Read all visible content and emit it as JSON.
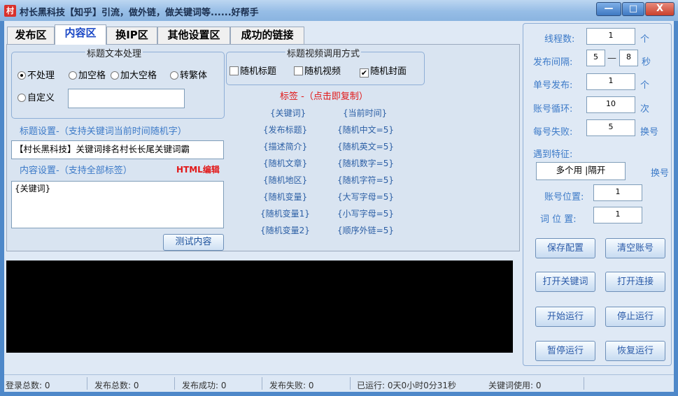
{
  "window": {
    "title": "村长黑科技【知乎】引流，做外链，做关键词等......好帮手",
    "app_icon_char": "村",
    "min_symbol": "—",
    "max_symbol": "□",
    "close_symbol": "X"
  },
  "tabs": [
    {
      "label": "发布区"
    },
    {
      "label": "内容区"
    },
    {
      "label": "换IP区"
    },
    {
      "label": "其他设置区"
    },
    {
      "label": "成功的链接"
    }
  ],
  "title_processing": {
    "group_title": "标题文本处理",
    "options": [
      "不处理",
      "加空格",
      "加大空格",
      "转繁体"
    ],
    "custom_label": "自定义",
    "custom_value": "",
    "selected": "不处理"
  },
  "video_mode": {
    "group_title": "标题视频调用方式",
    "checkboxes": [
      {
        "label": "随机标题",
        "checked": false
      },
      {
        "label": "随机视频",
        "checked": false
      },
      {
        "label": "随机封面",
        "checked": true
      }
    ]
  },
  "title_settings": {
    "label": "标题设置-（支持关键词当前时间随机字）",
    "value": "【村长黑科技】关键词排名村长长尾关键词霸"
  },
  "content_settings": {
    "label": "内容设置-（支持全部标签）",
    "html_edit": "HTML编辑",
    "value": "{关键词}",
    "test_button": "测试内容"
  },
  "tags": {
    "header": "标签 -（点击即复制）",
    "left": [
      "{关键词}",
      "{发布标题}",
      "{描述简介}",
      "{随机文章}",
      "{随机地区}",
      "{随机变量}",
      "{随机变量1}",
      "{随机变量2}"
    ],
    "right": [
      "{当前时间}",
      "{随机中文=5}",
      "{随机英文=5}",
      "{随机数字=5}",
      "{随机字符=5}",
      "{大写字母=5}",
      "{小写字母=5}",
      "{顺序外链=5}"
    ]
  },
  "right_panel": {
    "threads": {
      "label": "线程数:",
      "value": "1",
      "unit": "个"
    },
    "interval": {
      "label": "发布间隔:",
      "from": "5",
      "sep": "—",
      "to": "8",
      "unit": "秒"
    },
    "per_account": {
      "label": "单号发布:",
      "value": "1",
      "unit": "个"
    },
    "account_loop": {
      "label": "账号循环:",
      "value": "10",
      "unit": "次"
    },
    "fail_limit": {
      "label": "每号失败:",
      "value": "5",
      "unit": "换号"
    },
    "feature": {
      "label": "遇到特征:",
      "value": "多个用 |隔开",
      "unit": "换号"
    },
    "account_pos": {
      "label": "账号位置:",
      "value": "1"
    },
    "word_pos": {
      "label": "词 位 置:",
      "value": "1"
    },
    "buttons": [
      "保存配置",
      "清空账号",
      "打开关键词",
      "打开连接",
      "开始运行",
      "停止运行",
      "暂停运行",
      "恢复运行"
    ]
  },
  "status_bar": [
    "登录总数: 0",
    "发布总数: 0",
    "发布成功: 0",
    "发布失败: 0",
    "已运行: 0天0小时0分31秒",
    "关键词使用: 0"
  ]
}
